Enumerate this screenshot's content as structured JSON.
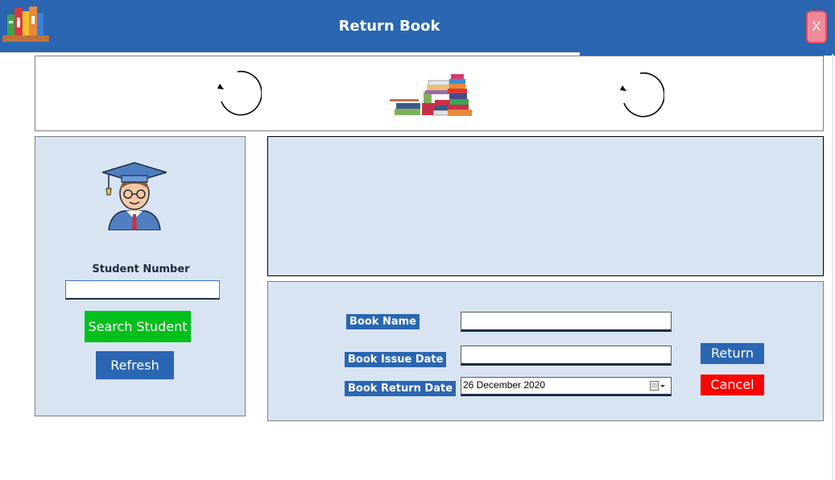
{
  "window": {
    "title": "Return Book",
    "close_label": "X"
  },
  "student": {
    "label": "Student Number",
    "value": ""
  },
  "buttons": {
    "search": "Search Student",
    "refresh": "Refresh",
    "return": "Return",
    "cancel": "Cancel"
  },
  "form": {
    "book_name_label": "Book Name",
    "book_name_value": "",
    "issue_date_label": "Book Issue Date",
    "issue_date_value": "",
    "return_date_label": "Book Return Date",
    "return_date_value": "26 December 2020"
  },
  "icons": [
    "books-logo-icon",
    "close-icon",
    "refresh-icon",
    "book-stack-icon",
    "graduate-avatar-icon",
    "calendar-icon",
    "dropdown-arrow-icon"
  ],
  "colors": {
    "primary": "#2a66b1",
    "panel": "#d9e4f2",
    "search": "#00c11c",
    "cancel": "#ff0000",
    "close": "#f08a98"
  }
}
